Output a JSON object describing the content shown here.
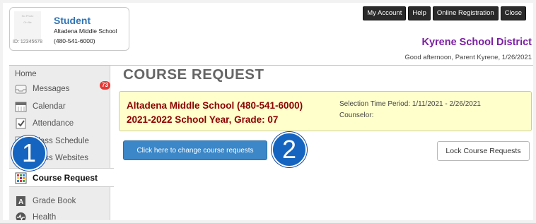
{
  "student": {
    "photo_label": "No Photo",
    "photo_sublabel": "On file",
    "name": "Student",
    "school": "Altadena Middle School",
    "phone": "(480-541-6000)",
    "id": "ID: 12345678"
  },
  "top_nav": {
    "my_account": "My Account",
    "help": "Help",
    "online_registration": "Online Registration",
    "close": "Close"
  },
  "district": "Kyrene School District",
  "greeting": "Good afternoon, Parent Kyrene, 1/26/2021",
  "sidebar": {
    "items": [
      {
        "label": "Home",
        "icon": "home"
      },
      {
        "label": "Messages",
        "icon": "inbox-icon",
        "badge": "73"
      },
      {
        "label": "Calendar",
        "icon": "calendar-icon"
      },
      {
        "label": "Attendance",
        "icon": "attendance-icon"
      },
      {
        "label": "Class Schedule",
        "icon": "schedule-icon"
      },
      {
        "label": "Class Websites",
        "icon": "websites-icon"
      },
      {
        "label": "Course Request",
        "icon": "course-request-icon",
        "active": true
      },
      {
        "label": "Grade Book",
        "icon": "gradebook-icon"
      },
      {
        "label": "Health",
        "icon": "health-icon"
      }
    ]
  },
  "page_title": "COURSE REQUEST",
  "info": {
    "school_line": "Altadena Middle School (480-541-6000)",
    "year_line": "2021-2022 School Year, Grade: 07",
    "selection_period": "Selection Time Period: 1/11/2021 - 2/26/2021",
    "counselor": "Counselor:"
  },
  "buttons": {
    "change_requests": "Click here to change course requests",
    "lock_requests": "Lock Course Requests"
  },
  "steps": {
    "step1": "1",
    "step2": "2"
  },
  "colors": {
    "accent_blue": "#3b87c8",
    "district_purple": "#7b1fa2",
    "alert_red": "#8b0000",
    "info_yellow": "#ffffcc",
    "step_blue": "#1565c0"
  }
}
